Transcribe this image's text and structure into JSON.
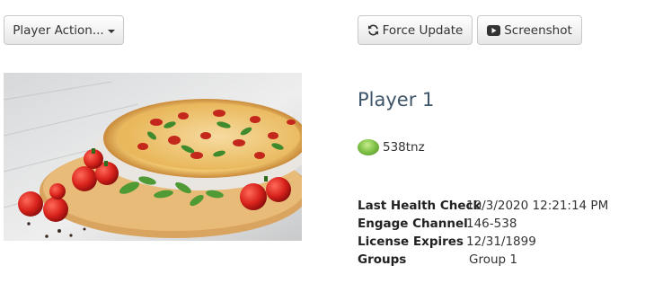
{
  "toolbar": {
    "actions_label": "Player Action...",
    "force_update_label": "Force Update",
    "screenshot_label": "Screenshot"
  },
  "player": {
    "name": "Player 1",
    "status_color": "#83c44a",
    "code": "538tnz"
  },
  "details": [
    {
      "label": "Last Health Check",
      "value": "10/3/2020 12:21:14 PM"
    },
    {
      "label": "Engage Channel",
      "value": "146-538"
    },
    {
      "label": "License Expires",
      "value": "12/31/1899"
    },
    {
      "label": "Groups",
      "value": "Group 1"
    }
  ],
  "icons": {
    "force_update": "refresh-icon",
    "screenshot": "youtube-play-icon",
    "dropdown": "caret-down-icon"
  }
}
